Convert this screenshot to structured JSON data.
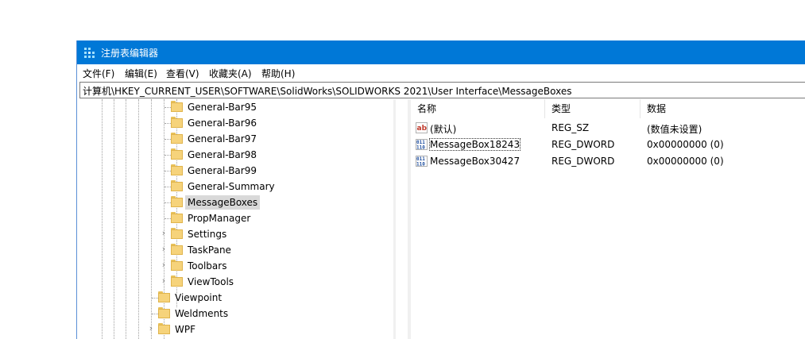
{
  "window": {
    "title": "注册表编辑器"
  },
  "menu": [
    "文件(F)",
    "编辑(E)",
    "查看(V)",
    "收藏夹(A)",
    "帮助(H)"
  ],
  "address": "计算机\\HKEY_CURRENT_USER\\SOFTWARE\\SolidWorks\\SOLIDWORKS 2021\\User Interface\\MessageBoxes",
  "tree": {
    "nodes": [
      {
        "label": "General-Bar95",
        "expandable": false,
        "selected": false
      },
      {
        "label": "General-Bar96",
        "expandable": false,
        "selected": false
      },
      {
        "label": "General-Bar97",
        "expandable": false,
        "selected": false
      },
      {
        "label": "General-Bar98",
        "expandable": false,
        "selected": false
      },
      {
        "label": "General-Bar99",
        "expandable": false,
        "selected": false
      },
      {
        "label": "General-Summary",
        "expandable": false,
        "selected": false
      },
      {
        "label": "MessageBoxes",
        "expandable": false,
        "selected": true
      },
      {
        "label": "PropManager",
        "expandable": false,
        "selected": false
      },
      {
        "label": "Settings",
        "expandable": true,
        "selected": false
      },
      {
        "label": "TaskPane",
        "expandable": true,
        "selected": false
      },
      {
        "label": "Toolbars",
        "expandable": true,
        "selected": false
      },
      {
        "label": "ViewTools",
        "expandable": true,
        "selected": false
      },
      {
        "label": "Viewpoint",
        "expandable": false,
        "selected": false
      },
      {
        "label": "Weldments",
        "expandable": false,
        "selected": false
      },
      {
        "label": "WPF",
        "expandable": true,
        "selected": false
      }
    ]
  },
  "list": {
    "columns": [
      "名称",
      "类型",
      "数据"
    ],
    "rows": [
      {
        "name": "(默认)",
        "type": "REG_SZ",
        "data": "(数值未设置)",
        "icon": "string-value-icon"
      },
      {
        "name": "MessageBox18243",
        "type": "REG_DWORD",
        "data": "0x00000000 (0)",
        "icon": "dword-value-icon"
      },
      {
        "name": "MessageBox30427",
        "type": "REG_DWORD",
        "data": "0x00000000 (0)",
        "icon": "dword-value-icon"
      }
    ]
  },
  "colors": {
    "titlebar": "#0078d7",
    "selection": "#d9d9d9",
    "folder": "#f6d37b"
  }
}
